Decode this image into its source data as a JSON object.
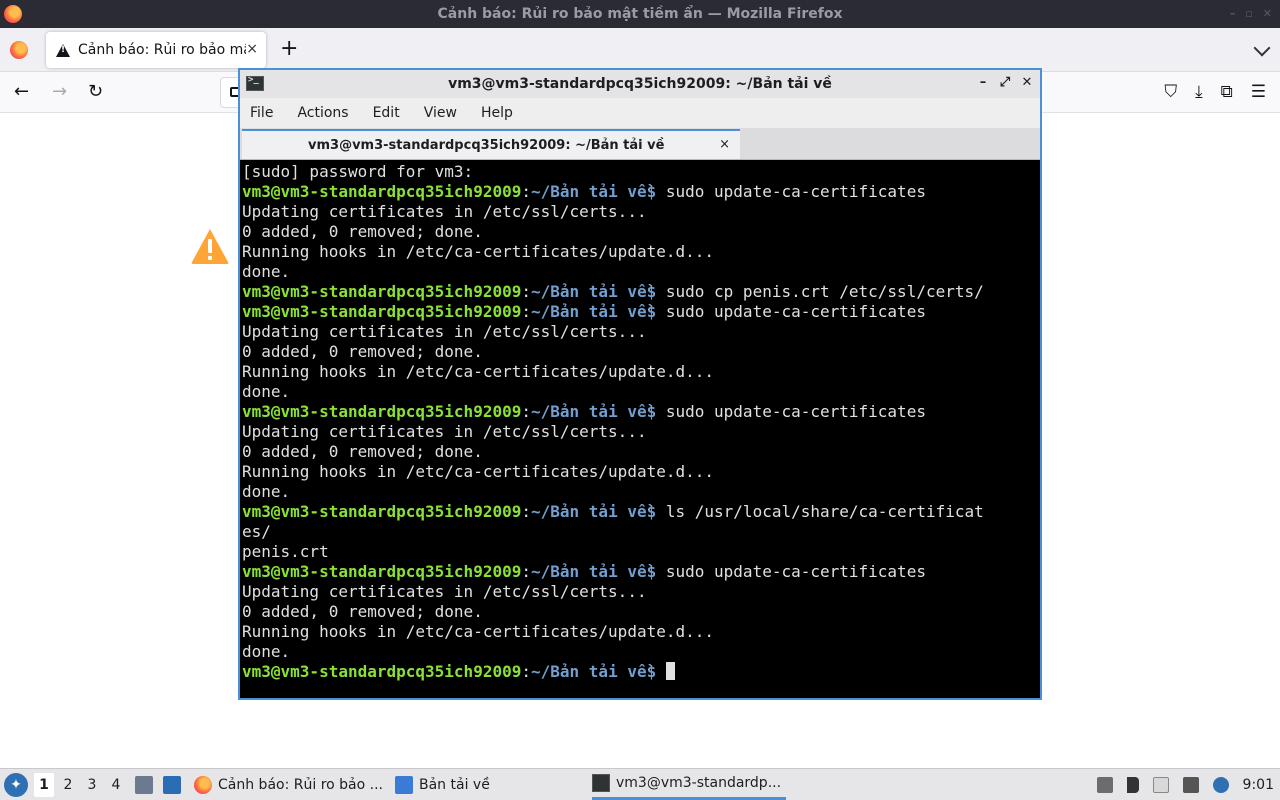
{
  "firefox": {
    "window_title": "Cảnh báo: Rủi ro bảo mật tiềm ẩn — Mozilla Firefox",
    "tab_title": "Cảnh báo: Rủi ro bảo mật tiềm ẩn",
    "tab_close": "×",
    "new_tab": "+",
    "nav": {
      "back": "←",
      "forward": "→",
      "reload": "↻"
    }
  },
  "terminal": {
    "title": "vm3@vm3-standardpcq35ich92009: ~/Bản tải về",
    "menu": [
      "File",
      "Actions",
      "Edit",
      "View",
      "Help"
    ],
    "tab_title": "vm3@vm3-standardpcq35ich92009: ~/Bản tải về",
    "tab_close": "×",
    "prompt": {
      "user": "vm3@vm3-standardpcq35ich92009",
      "sep": ":",
      "path": "~/Bản tải về",
      "dollar": "$"
    },
    "lines": [
      {
        "type": "out",
        "text": "[sudo] password for vm3:"
      },
      {
        "type": "cmd",
        "text": " sudo update-ca-certificates"
      },
      {
        "type": "out",
        "text": "Updating certificates in /etc/ssl/certs..."
      },
      {
        "type": "out",
        "text": "0 added, 0 removed; done."
      },
      {
        "type": "out",
        "text": "Running hooks in /etc/ca-certificates/update.d..."
      },
      {
        "type": "out",
        "text": "done."
      },
      {
        "type": "cmd",
        "text": " sudo cp penis.crt /etc/ssl/certs/"
      },
      {
        "type": "cmd",
        "text": " sudo update-ca-certificates"
      },
      {
        "type": "out",
        "text": "Updating certificates in /etc/ssl/certs..."
      },
      {
        "type": "out",
        "text": "0 added, 0 removed; done."
      },
      {
        "type": "out",
        "text": "Running hooks in /etc/ca-certificates/update.d..."
      },
      {
        "type": "out",
        "text": "done."
      },
      {
        "type": "cmd",
        "text": " sudo update-ca-certificates"
      },
      {
        "type": "out",
        "text": "Updating certificates in /etc/ssl/certs..."
      },
      {
        "type": "out",
        "text": "0 added, 0 removed; done."
      },
      {
        "type": "out",
        "text": "Running hooks in /etc/ca-certificates/update.d..."
      },
      {
        "type": "out",
        "text": "done."
      },
      {
        "type": "cmd",
        "text": " ls /usr/local/share/ca-certificat"
      },
      {
        "type": "out",
        "text": "es/"
      },
      {
        "type": "out",
        "text": "penis.crt"
      },
      {
        "type": "cmd",
        "text": " sudo update-ca-certificates"
      },
      {
        "type": "out",
        "text": "Updating certificates in /etc/ssl/certs..."
      },
      {
        "type": "out",
        "text": "0 added, 0 removed; done."
      },
      {
        "type": "out",
        "text": "Running hooks in /etc/ca-certificates/update.d..."
      },
      {
        "type": "out",
        "text": "done."
      },
      {
        "type": "cmd",
        "text": " ",
        "cursor": true
      }
    ]
  },
  "taskbar": {
    "workspaces": [
      "1",
      "2",
      "3",
      "4"
    ],
    "active_workspace": "1",
    "tasks": [
      {
        "label": "Cảnh báo: Rủi ro bảo ...",
        "icon": "firefox-icon"
      },
      {
        "label": "Bản tải về",
        "icon": "folder-icon"
      },
      {
        "label": "vm3@vm3-standardp...",
        "icon": "terminal-icon"
      }
    ],
    "clock": "9:01"
  }
}
